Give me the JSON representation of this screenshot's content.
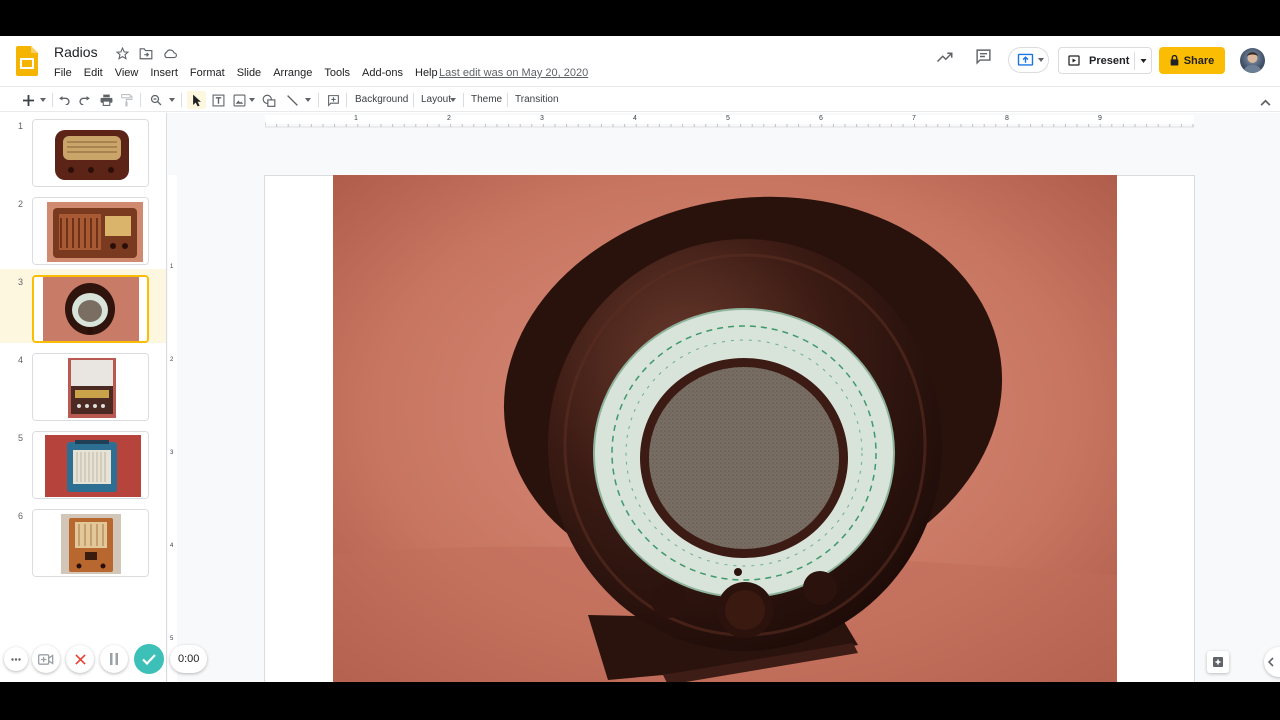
{
  "document": {
    "title": "Radios",
    "last_edit": "Last edit was on May 20, 2020"
  },
  "menu": [
    "File",
    "Edit",
    "View",
    "Insert",
    "Format",
    "Slide",
    "Arrange",
    "Tools",
    "Add-ons",
    "Help"
  ],
  "header": {
    "present_label": "Present",
    "share_label": "Share"
  },
  "toolbar": {
    "background": "Background",
    "layout": "Layout",
    "theme": "Theme",
    "transition": "Transition"
  },
  "ruler": {
    "horizontal": [
      "1",
      "2",
      "3",
      "4",
      "5",
      "6",
      "7",
      "8",
      "9"
    ],
    "vertical": [
      "1",
      "2",
      "3",
      "4",
      "5"
    ]
  },
  "slides": [
    {
      "number": "1",
      "selected": false
    },
    {
      "number": "2",
      "selected": false
    },
    {
      "number": "3",
      "selected": true
    },
    {
      "number": "4",
      "selected": false
    },
    {
      "number": "5",
      "selected": false
    },
    {
      "number": "6",
      "selected": false
    }
  ],
  "recorder": {
    "time": "0:00"
  },
  "colors": {
    "accent": "#fbbc04",
    "selected_bg": "#fef7e0",
    "record_check": "#3cc0b8"
  }
}
